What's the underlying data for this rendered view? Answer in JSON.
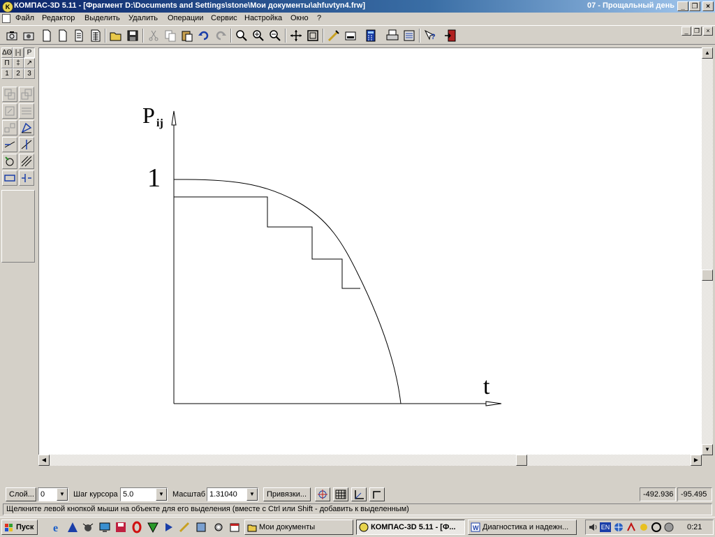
{
  "window": {
    "title": "КОМПАС-3D 5.11 - [Фрагмент D:\\Documents and Settings\\stone\\Мои документы\\ahfuvtyn4.frw]",
    "right_text": "07 - Прощальный день",
    "minimize": "_",
    "maximize": "❐",
    "close": "×"
  },
  "menu": {
    "items": [
      "Файл",
      "Редактор",
      "Выделить",
      "Удалить",
      "Операции",
      "Сервис",
      "Настройка",
      "Окно",
      "?"
    ]
  },
  "toolbar": {
    "icons": [
      "screenshot-icon",
      "print-preview-icon",
      "new-document-icon",
      "new-fragment-icon",
      "new-text-icon",
      "new-spec-icon",
      "open-folder-icon",
      "save-icon",
      "cut-icon",
      "copy-icon",
      "paste-icon",
      "undo-icon",
      "redo-icon",
      "zoom-window-icon",
      "zoom-in-icon",
      "zoom-out-icon",
      "pan-icon",
      "zoom-all-icon",
      "regen-icon",
      "layers-icon",
      "calculator-icon",
      "print-icon",
      "library-icon",
      "help-icon",
      "exit-icon"
    ]
  },
  "left_panel": {
    "tabs_row1": [
      "ΔΘ",
      "|-|",
      "P"
    ],
    "tabs_row2": [
      "П",
      "‡",
      "↗"
    ],
    "tabs_row3": [
      "1",
      "2",
      "3"
    ]
  },
  "drawing": {
    "y_axis_label": "P",
    "y_axis_subscript": "ij",
    "y_tick_label": "1",
    "x_axis_label": "t"
  },
  "bottom": {
    "layer_button": "Слой...",
    "layer_value": "0",
    "step_label": "Шаг курсора",
    "step_value": "5.0",
    "scale_label": "Масштаб",
    "scale_value": "1.31040",
    "snap_button": "Привязки...",
    "coord_x": "-492.936",
    "coord_y": "-95.495"
  },
  "status": {
    "text": "Щелкните левой кнопкой мыши на объекте для его выделения (вместе с Ctrl или Shift - добавить к выделенным)"
  },
  "taskbar": {
    "start": "Пуск",
    "tasks": [
      "Мои документы",
      "КОМПАС-3D 5.11 - [Ф...",
      "Диагностика и надежн..."
    ],
    "lang": "EN",
    "clock": "0:21"
  }
}
